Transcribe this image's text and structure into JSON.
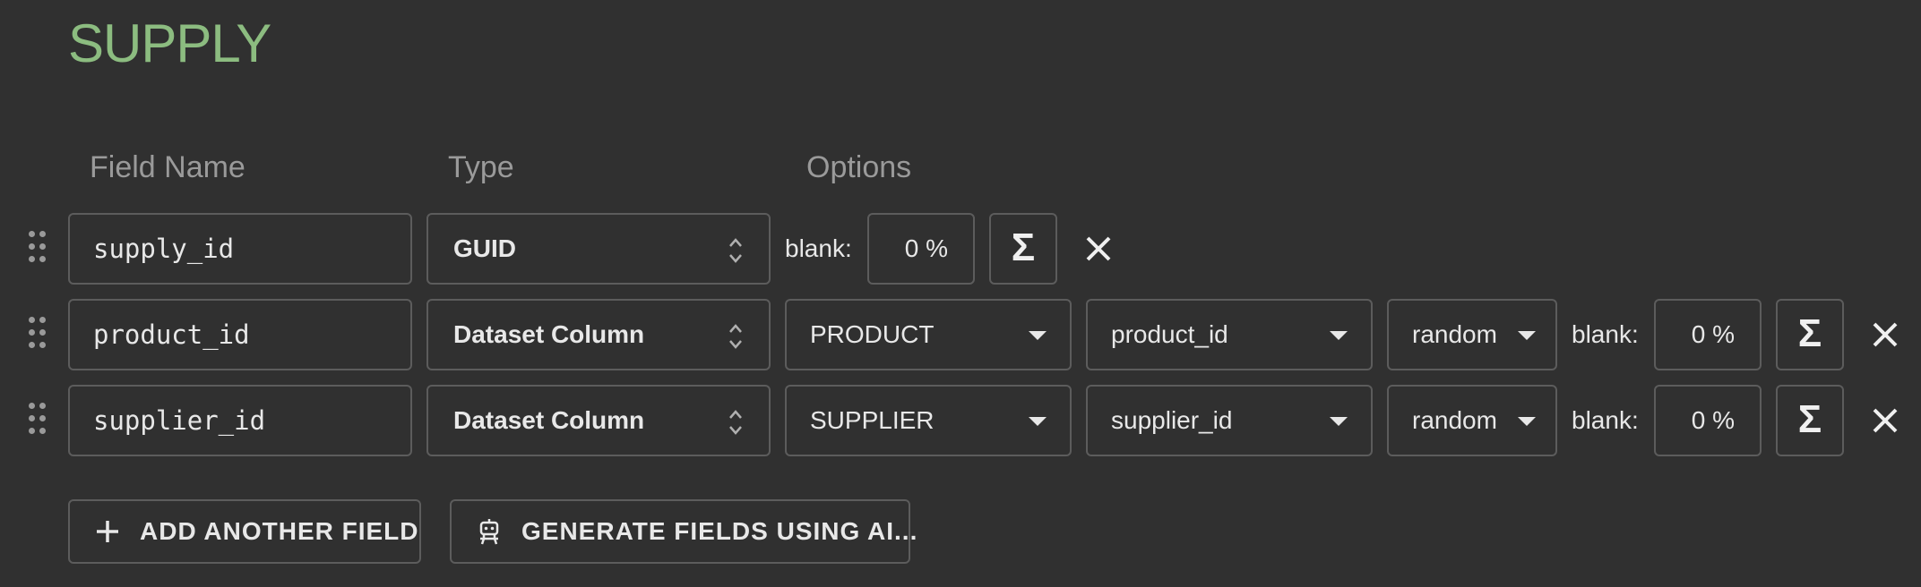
{
  "section": {
    "title": "SUPPLY"
  },
  "columns": {
    "field_name": "Field Name",
    "type": "Type",
    "options": "Options"
  },
  "rows": [
    {
      "field_name": "supply_id",
      "type": "GUID",
      "blank_label": "blank:",
      "blank_value": "0 %"
    },
    {
      "field_name": "product_id",
      "type": "Dataset Column",
      "dataset": "PRODUCT",
      "column": "product_id",
      "mode": "random",
      "blank_label": "blank:",
      "blank_value": "0 %"
    },
    {
      "field_name": "supplier_id",
      "type": "Dataset Column",
      "dataset": "SUPPLIER",
      "column": "supplier_id",
      "mode": "random",
      "blank_label": "blank:",
      "blank_value": "0 %"
    }
  ],
  "sigma_symbol": "Σ",
  "actions": {
    "add_field": "ADD ANOTHER FIELD",
    "generate_ai": "GENERATE FIELDS USING AI..."
  },
  "icons": {
    "drag": "drag-handle-icon",
    "updown": "unfold-icon",
    "caret": "caret-down-icon",
    "close": "close-icon",
    "plus": "plus-icon",
    "robot": "robot-icon"
  },
  "colors": {
    "background": "#303030",
    "title": "#8cbc80",
    "border": "#5c5c5c",
    "text": "#e8e8e8",
    "muted": "#9a9a9a"
  }
}
